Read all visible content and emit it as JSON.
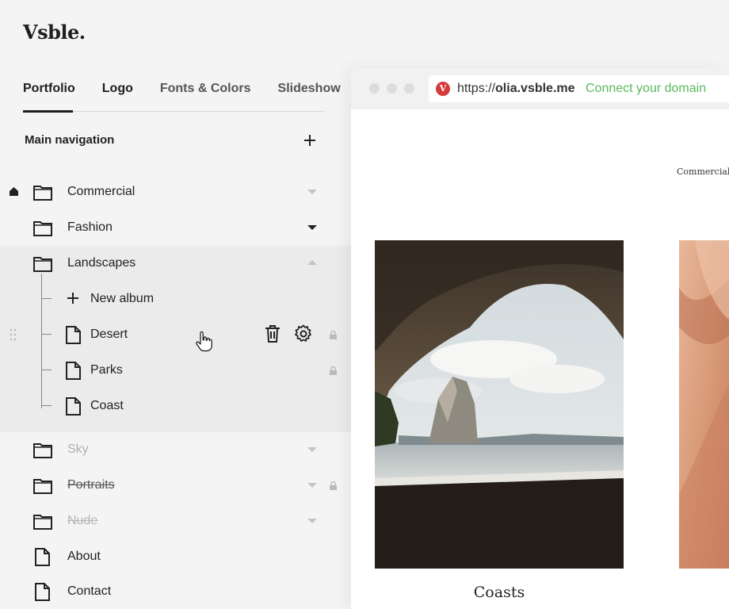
{
  "app": {
    "logo": "Vsble."
  },
  "tabs": [
    {
      "label": "Portfolio",
      "active": true
    },
    {
      "label": "Logo"
    },
    {
      "label": "Fonts & Colors"
    },
    {
      "label": "Slideshow"
    }
  ],
  "nav": {
    "title": "Main navigation",
    "add_icon": "plus-icon",
    "items": [
      {
        "label": "Commercial",
        "type": "folder",
        "home": true
      },
      {
        "label": "Fashion",
        "type": "folder"
      },
      {
        "label": "Landscapes",
        "type": "folder",
        "expanded": true,
        "children": [
          {
            "label": "New album",
            "type": "add"
          },
          {
            "label": "Desert",
            "type": "page",
            "hover": true
          },
          {
            "label": "Parks",
            "type": "page"
          },
          {
            "label": "Coast",
            "type": "page"
          }
        ]
      },
      {
        "label": "Sky",
        "type": "folder",
        "hidden": true
      },
      {
        "label": "Portraits",
        "type": "folder",
        "disabled": true
      },
      {
        "label": "Nude",
        "type": "folder",
        "hidden": true,
        "disabled": true
      },
      {
        "label": "About",
        "type": "page"
      },
      {
        "label": "Contact",
        "type": "page"
      }
    ]
  },
  "preview": {
    "url_prefix": "https://",
    "url_host": "olia.vsble.me",
    "connect": "Connect your domain",
    "site_nav": "Commercial",
    "caption": "Coasts"
  },
  "colors": {
    "accent_green": "#5cb85c",
    "brand_red": "#d63a3a"
  }
}
